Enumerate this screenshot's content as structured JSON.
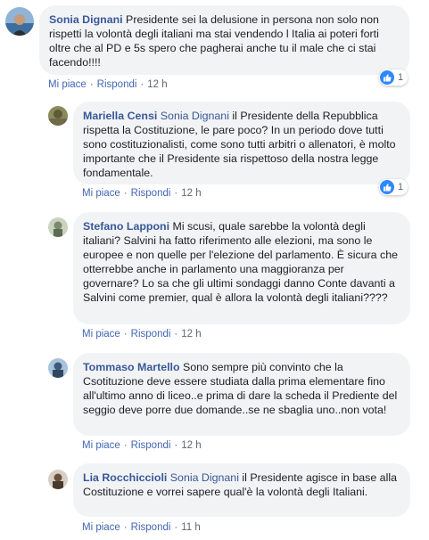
{
  "comments": [
    {
      "author": "Sonia Dignani",
      "mention": "",
      "text": " Presidente sei la delusione in persona non solo non rispetti la volontà degli italiani ma stai vendendo l Italia ai poteri forti oltre che al PD e 5s spero che pagherai anche tu il male che ci stai facendo!!!!",
      "like_label": "Mi piace",
      "reply_label": "Rispondi",
      "time": "12 h",
      "reaction_count": "1",
      "reaction_icon": "like-icon"
    },
    {
      "author": "Mariella Censi",
      "mention": "Sonia Dignani",
      "text": " il Presidente della Repubblica rispetta la Costituzione, le pare poco? In un periodo dove tutti sono costituzionalisti, come sono tutti arbitri o allenatori, è molto importante che il Presidente sia rispettoso della nostra legge fondamentale.",
      "like_label": "Mi piace",
      "reply_label": "Rispondi",
      "time": "12 h",
      "reaction_count": "1",
      "reaction_icon": "like-icon"
    },
    {
      "author": "Stefano Lapponi",
      "mention": "",
      "text": " Mi scusi, quale sarebbe la volontà degli italiani? Salvini ha fatto riferimento alle elezioni, ma sono le europee e non quelle per l'elezione del parlamento. È sicura che otterrebbe anche in parlamento una maggioranza per governare? Lo sa che gli ultimi sondaggi danno Conte davanti a Salvini come premier, qual è allora la volontà degli italiani????",
      "like_label": "Mi piace",
      "reply_label": "Rispondi",
      "time": "12 h"
    },
    {
      "author": "Tommaso Martello",
      "mention": "",
      "text": " Sono sempre più convinto che la Csotituzione deve essere studiata dalla prima elementare fino all'ultimo anno di liceo..e prima di dare la scheda il Prediente del seggio deve porre due domande..se ne sbaglia uno..non vota!",
      "like_label": "Mi piace",
      "reply_label": "Rispondi",
      "time": "12 h"
    },
    {
      "author": "Lia Rocchiccioli",
      "mention": "Sonia Dignani",
      "text": " il Presidente agisce in base alla Costituzione e vorrei sapere qual'è la volontà degli Italiani.",
      "like_label": "Mi piace",
      "reply_label": "Rispondi",
      "time": "11 h"
    }
  ],
  "colors": {
    "author": "#385898",
    "bubble": "#f2f3f5",
    "action_link": "#4267b2",
    "like_badge": "#2d88ff"
  }
}
